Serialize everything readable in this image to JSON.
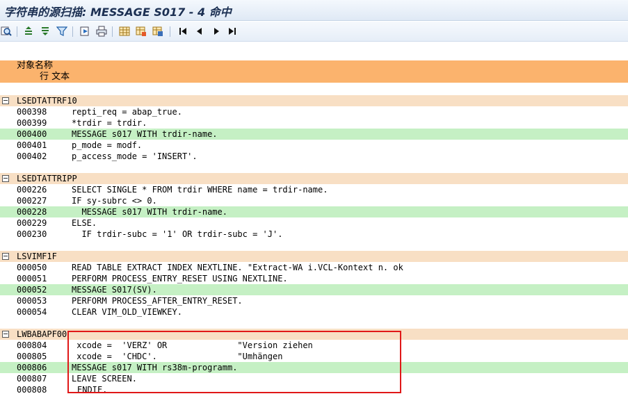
{
  "window": {
    "title": "字符串的源扫描:  MESSAGE S017 - 4 命中"
  },
  "toolbar": {
    "buttons": [
      {
        "name": "find-icon"
      },
      {
        "name": "sort-ascending-icon"
      },
      {
        "name": "sort-descending-icon"
      },
      {
        "name": "filter-icon"
      },
      {
        "name": "export-icon"
      },
      {
        "name": "print-icon"
      },
      {
        "name": "layout-icon"
      },
      {
        "name": "layout-change-icon"
      },
      {
        "name": "layout-save-icon"
      },
      {
        "name": "first-page-icon"
      },
      {
        "name": "previous-page-icon"
      },
      {
        "name": "next-page-icon"
      },
      {
        "name": "last-page-icon"
      }
    ]
  },
  "header": {
    "object_name": "对象名称",
    "line_text": "行 文本"
  },
  "groups": [
    {
      "name": "LSEDTATTRF10",
      "lines": [
        {
          "num": "000398",
          "code": "repti_req = abap_true.",
          "hit": false
        },
        {
          "num": "000399",
          "code": "*trdir = trdir.",
          "hit": false
        },
        {
          "num": "000400",
          "code": "MESSAGE s017 WITH trdir-name.",
          "hit": true
        },
        {
          "num": "000401",
          "code": "p_mode = modf.",
          "hit": false
        },
        {
          "num": "000402",
          "code": "p_access_mode = 'INSERT'.",
          "hit": false
        }
      ]
    },
    {
      "name": "LSEDTATTRIPP",
      "lines": [
        {
          "num": "000226",
          "code": "SELECT SINGLE * FROM trdir WHERE name = trdir-name.",
          "hit": false
        },
        {
          "num": "000227",
          "code": "IF sy-subrc <> 0.",
          "hit": false
        },
        {
          "num": "000228",
          "code": "  MESSAGE s017 WITH trdir-name.",
          "hit": true
        },
        {
          "num": "000229",
          "code": "ELSE.",
          "hit": false
        },
        {
          "num": "000230",
          "code": "  IF trdir-subc = '1' OR trdir-subc = 'J'.",
          "hit": false
        }
      ]
    },
    {
      "name": "LSVIMF1F",
      "lines": [
        {
          "num": "000050",
          "code": "READ TABLE EXTRACT INDEX NEXTLINE. \"Extract-WA i.VCL-Kontext n. ok",
          "hit": false
        },
        {
          "num": "000051",
          "code": "PERFORM PROCESS_ENTRY_RESET USING NEXTLINE.",
          "hit": false
        },
        {
          "num": "000052",
          "code": "MESSAGE S017(SV).",
          "hit": true
        },
        {
          "num": "000053",
          "code": "PERFORM PROCESS_AFTER_ENTRY_RESET.",
          "hit": false
        },
        {
          "num": "000054",
          "code": "CLEAR VIM_OLD_VIEWKEY.",
          "hit": false
        }
      ]
    },
    {
      "name": "LWBABAPF00",
      "lines": [
        {
          "num": "000804",
          "code": " xcode =  'VERZ' OR              \"Version ziehen",
          "hit": false
        },
        {
          "num": "000805",
          "code": " xcode =  'CHDC'.                \"Umhängen",
          "hit": false
        },
        {
          "num": "000806",
          "code": "MESSAGE s017 WITH rs38m-programm.",
          "hit": true
        },
        {
          "num": "000807",
          "code": "LEAVE SCREEN.",
          "hit": false
        },
        {
          "num": "000808",
          "code": "ENDIF.",
          "hit": false,
          "outdent": true
        }
      ]
    }
  ],
  "colors": {
    "header": "#fbb36d",
    "group": "#f8dfc4",
    "hit": "#c5f0c4",
    "highlight_box": "#e01818"
  }
}
